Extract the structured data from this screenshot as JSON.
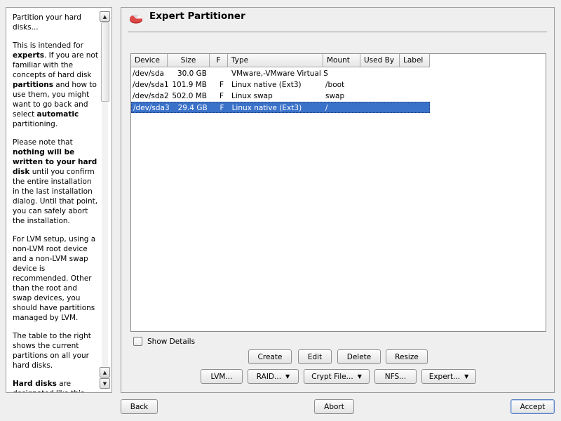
{
  "help": {
    "paragraphs": [
      [
        {
          "t": "Partition your hard disks..."
        }
      ],
      [
        {
          "t": "This is intended for "
        },
        {
          "t": "experts",
          "b": true
        },
        {
          "t": ". If you are not familiar with the concepts of hard disk "
        },
        {
          "t": "partitions",
          "b": true
        },
        {
          "t": " and how to use them, you might want to go back and select "
        },
        {
          "t": "automatic",
          "b": true
        },
        {
          "t": " partitioning."
        }
      ],
      [
        {
          "t": "Please note that "
        },
        {
          "t": "nothing will be written to your hard disk",
          "b": true
        },
        {
          "t": " until you confirm the entire installation in the last installation dialog. Until that point, you can safely abort the installation."
        }
      ],
      [
        {
          "t": "For LVM setup, using a non-LVM root device and a non-LVM swap device is recommended. Other than the root and swap devices, you should have partitions managed by LVM."
        }
      ],
      [
        {
          "t": "The table to the right shows the current partitions on all your hard disks."
        }
      ],
      [
        {
          "t": "Hard disks",
          "b": true
        },
        {
          "t": " are designated like this"
        }
      ]
    ]
  },
  "main": {
    "title": "Expert Partitioner",
    "table": {
      "headers": [
        "Device",
        "Size",
        "F",
        "Type",
        "Mount",
        "Used By",
        "Label"
      ],
      "rows": [
        {
          "device": "/dev/sda",
          "size": "30.0 GB",
          "f": "",
          "type": "VMware,-VMware Virtual S",
          "mount": "",
          "used_by": "",
          "label": "",
          "selected": false
        },
        {
          "device": "/dev/sda1",
          "size": "101.9 MB",
          "f": "F",
          "type": "Linux native (Ext3)",
          "mount": "/boot",
          "used_by": "",
          "label": "",
          "selected": false
        },
        {
          "device": "/dev/sda2",
          "size": "502.0 MB",
          "f": "F",
          "type": "Linux swap",
          "mount": "swap",
          "used_by": "",
          "label": "",
          "selected": false
        },
        {
          "device": "/dev/sda3",
          "size": "29.4 GB",
          "f": "F",
          "type": "Linux native (Ext3)",
          "mount": "/",
          "used_by": "",
          "label": "",
          "selected": true
        }
      ]
    },
    "show_details": {
      "label": "Show Details",
      "checked": false
    },
    "buttons_row1": {
      "create": "Create",
      "edit": "Edit",
      "delete": "Delete",
      "resize": "Resize"
    },
    "buttons_row2": {
      "lvm": "LVM...",
      "raid": "RAID...",
      "crypt": "Crypt File...",
      "nfs": "NFS...",
      "expert": "Expert..."
    }
  },
  "footer": {
    "back": "Back",
    "abort": "Abort",
    "accept": "Accept"
  },
  "icons": {
    "title": "partition-pie-icon",
    "scroll_up": "arrow-up-icon",
    "scroll_down": "arrow-down-icon",
    "dropdown": "caret-down-icon"
  },
  "colors": {
    "selection": "#3b72c9",
    "panel_bg": "#efefef",
    "border": "#9a9a9a"
  }
}
